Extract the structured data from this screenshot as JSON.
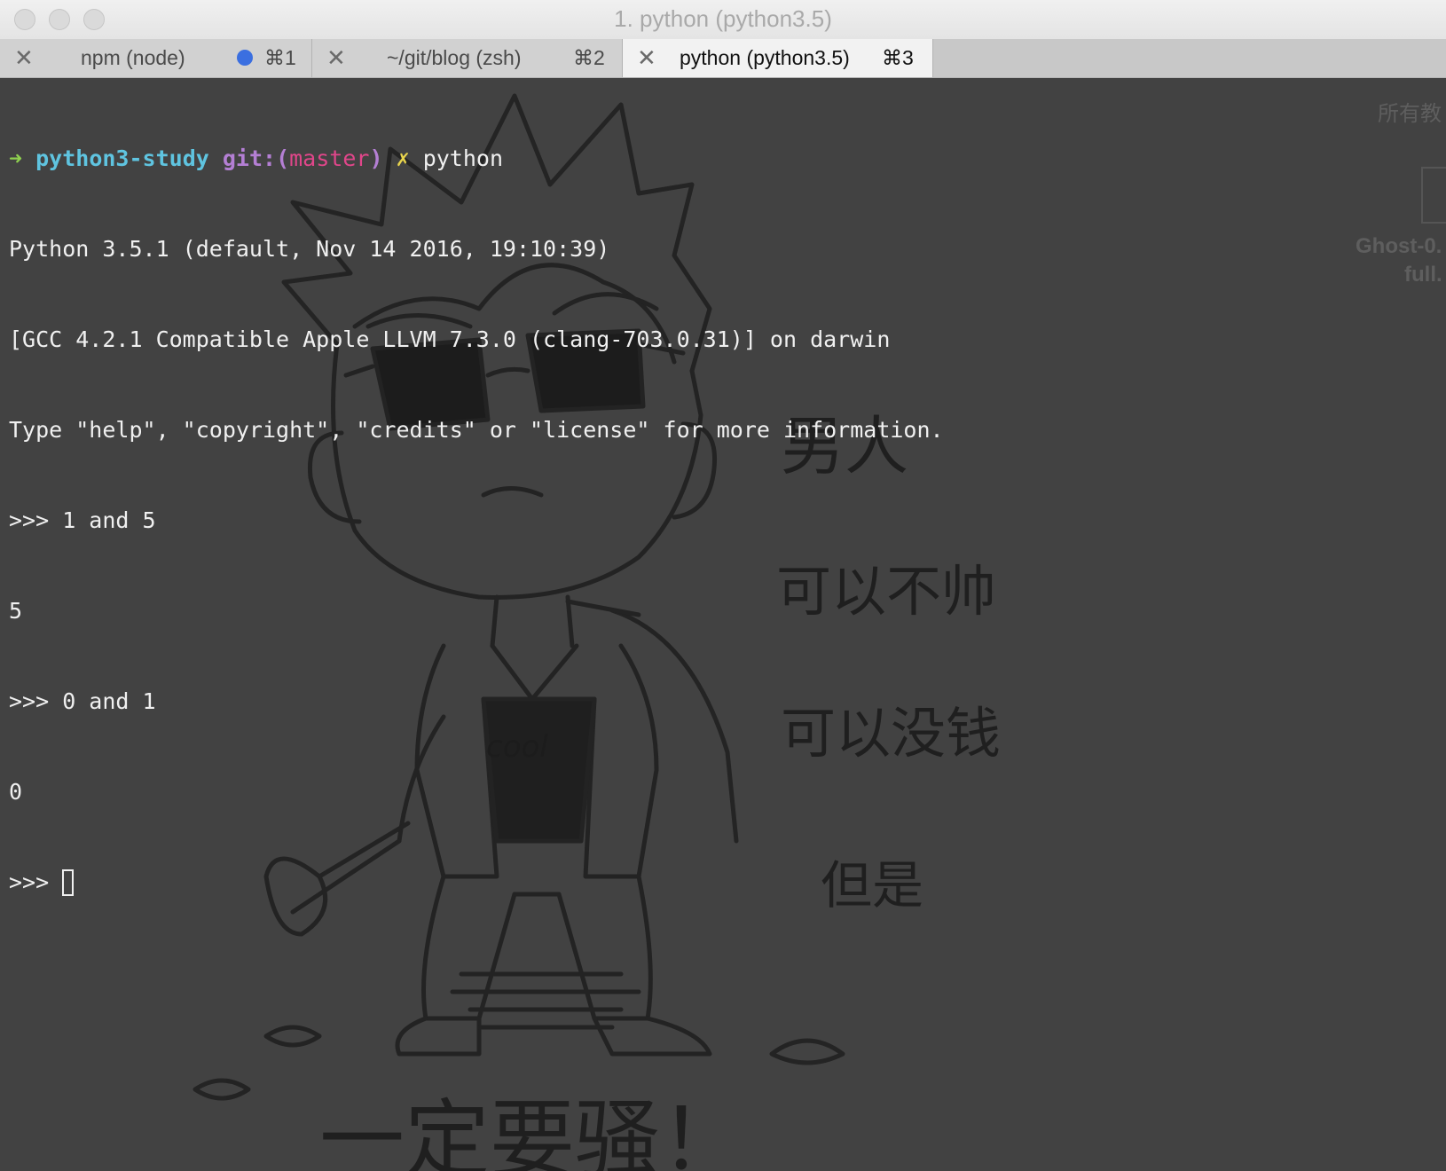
{
  "window": {
    "title": "1. python (python3.5)"
  },
  "tabs": [
    {
      "label": "npm (node)",
      "shortcut": "⌘1",
      "active": false,
      "has_dot": true
    },
    {
      "label": "~/git/blog (zsh)",
      "shortcut": "⌘2",
      "active": false,
      "has_dot": false
    },
    {
      "label": "python (python3.5)",
      "shortcut": "⌘3",
      "active": true,
      "has_dot": false
    }
  ],
  "terminal": {
    "prompt": {
      "arrow": "➜",
      "dir": "python3-study",
      "git_prefix": "git:(",
      "branch": "master",
      "git_suffix": ")",
      "dirty": "✗",
      "command": "python"
    },
    "lines": [
      "Python 3.5.1 (default, Nov 14 2016, 19:10:39)",
      "[GCC 4.2.1 Compatible Apple LLVM 7.3.0 (clang-703.0.31)] on darwin",
      "Type \"help\", \"copyright\", \"credits\" or \"license\" for more information.",
      ">>> 1 and 5",
      "5",
      ">>> 0 and 1",
      "0"
    ],
    "current_prompt": ">>> "
  },
  "background_overlay": {
    "desktop_label": "所有教",
    "desktop_file": "Ghost-0.",
    "desktop_file_2": "full."
  },
  "background_art_text": {
    "cool": "cool",
    "line1": "男人",
    "line2": "可以不帅",
    "line3": "可以没钱",
    "line4": "但是",
    "line5": "一定要骚！"
  },
  "colors": {
    "terminal_bg": "#424242",
    "prompt_arrow": "#8fd14f",
    "prompt_dir": "#5fc4e0",
    "prompt_git": "#b47fd4",
    "prompt_branch": "#e0468a",
    "prompt_dirty": "#e8d44d",
    "tab_dot": "#3b6fe0"
  }
}
